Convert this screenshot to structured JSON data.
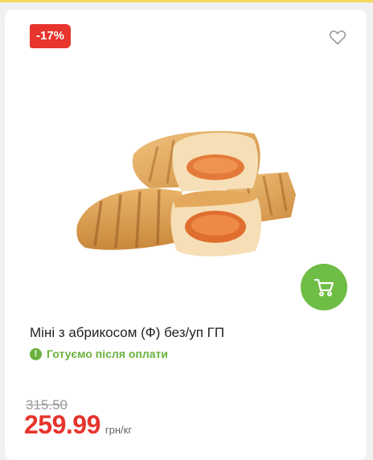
{
  "product": {
    "discount": "-17%",
    "title": "Міні з абрикосом (Ф) без/уп ГП",
    "status": "Готуємо після оплати",
    "old_price": "315.50",
    "price": "259.99",
    "unit": "грн/кг"
  },
  "colors": {
    "accent_red": "#e7342c",
    "accent_green": "#6ebd44",
    "top_strip": "#f4d860"
  },
  "icons": {
    "favorite": "heart-icon",
    "cart": "cart-icon",
    "status": "exclamation-icon"
  }
}
